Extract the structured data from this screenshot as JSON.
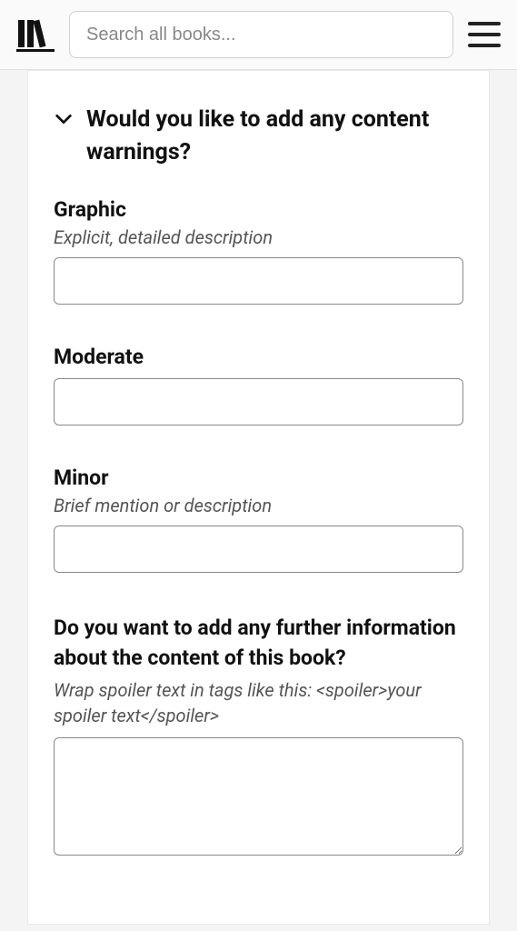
{
  "header": {
    "search_placeholder": "Search all books..."
  },
  "section": {
    "title": "Would you like to add any content warnings?"
  },
  "fields": {
    "graphic": {
      "label": "Graphic",
      "hint": "Explicit, detailed description",
      "value": ""
    },
    "moderate": {
      "label": "Moderate",
      "value": ""
    },
    "minor": {
      "label": "Minor",
      "hint": "Brief mention or description",
      "value": ""
    }
  },
  "further": {
    "label": "Do you want to add any further information about the content of this book?",
    "hint": "Wrap spoiler text in tags like this: <spoiler>your spoiler text</spoiler>",
    "value": ""
  }
}
